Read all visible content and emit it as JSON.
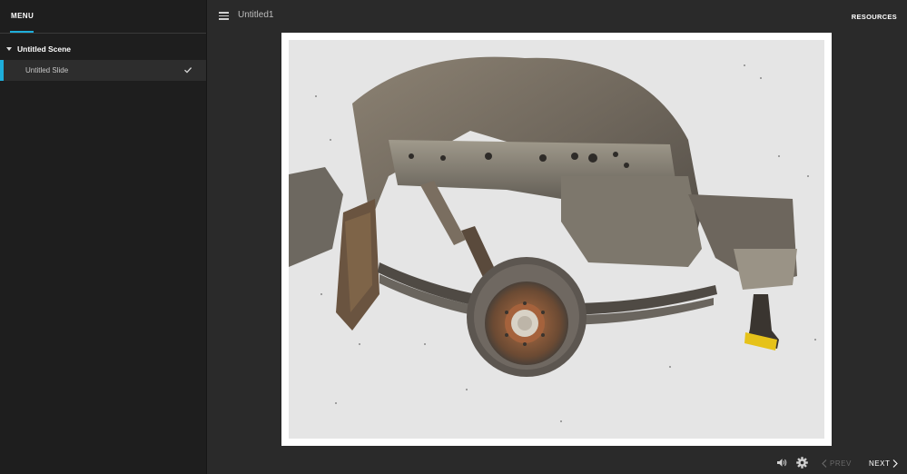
{
  "sidebar": {
    "menu_tab_label": "MENU",
    "scene": {
      "label": "Untitled Scene"
    },
    "slides": [
      {
        "label": "Untitled Slide",
        "completed": true
      }
    ]
  },
  "header": {
    "title": "Untitled1",
    "resources_label": "RESOURCES"
  },
  "slide": {
    "image_alt": "Rusted car underbody wheel assembly"
  },
  "controls": {
    "prev_label": "PREV",
    "next_label": "NEXT"
  },
  "colors": {
    "accent": "#1eaedb",
    "sidebar_bg": "#1e1e1e",
    "main_bg": "#2a2a2a"
  },
  "icons": {
    "menu": "hamburger-icon",
    "check": "check-icon",
    "volume": "volume-icon",
    "settings": "gear-icon",
    "prev": "chevron-left-icon",
    "next": "chevron-right-icon"
  }
}
